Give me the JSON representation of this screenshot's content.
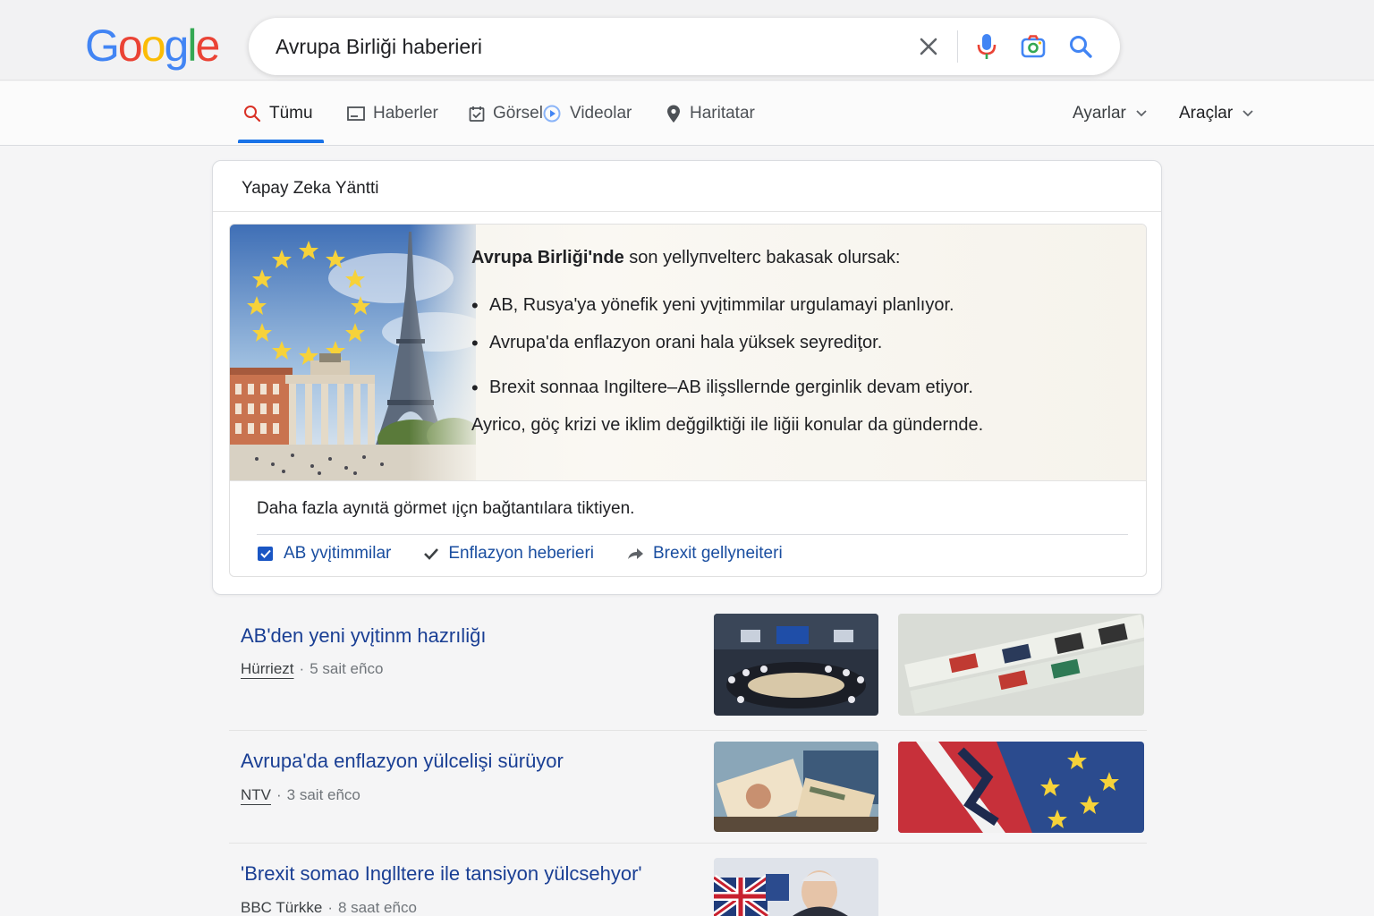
{
  "brand": {
    "logo_letters": [
      {
        "ch": "G",
        "color": "#4285F4"
      },
      {
        "ch": "o",
        "color": "#EA4335"
      },
      {
        "ch": "o",
        "color": "#FBBC05"
      },
      {
        "ch": "g",
        "color": "#4285F4"
      },
      {
        "ch": "l",
        "color": "#34A853"
      },
      {
        "ch": "e",
        "color": "#EA4335"
      }
    ]
  },
  "search": {
    "query": "Avrupa Birliği haberieri",
    "icons": [
      "clear-icon",
      "microphone-icon",
      "camera-lens-icon",
      "search-icon"
    ]
  },
  "tabs": [
    {
      "label": "Tümu",
      "icon": "search-icon",
      "active": true
    },
    {
      "label": "Haberler",
      "icon": "news-icon"
    },
    {
      "label": "Görsel",
      "icon": "image-icon"
    },
    {
      "label": "Videolar",
      "icon": "video-icon"
    },
    {
      "label": "Haritatar",
      "icon": "map-pin-icon"
    }
  ],
  "dropdowns": {
    "settings": "Ayarlar",
    "tools": "Araçlar"
  },
  "ai_answer": {
    "title": "Yapay Zeka Yäntti",
    "intro_bold": "Avrupa Birliği'nde",
    "intro_rest": " son yellyпvelterc bakasak olursak:",
    "bullets": [
      "AB, Rusya'ya yönefik yeni yvįtimmilar urgulamayi planlıyor.",
      "Avrupa'da enflazyon orani hala yüksek seyrediţor.",
      "Brexit sonnaa Ingiltere–AB ilişslleгnde gerginlik devam etiyor."
    ],
    "outro": "Ayrico, göç krizi ve iklim değgilktiği ile liğii konular da gündernde.",
    "more_text": "Daha fazla aynıtä görmet ıįçn bağtantılara tiktiyen.",
    "links": [
      {
        "label": "AB yvįtimmilar",
        "icon": "checkbox-icon"
      },
      {
        "label": "Enflazyon heberieri",
        "icon": "checkmark-icon"
      },
      {
        "label": "Brexit gellyneiteri",
        "icon": "share-arrow-icon"
      }
    ]
  },
  "results": [
    {
      "title": "AB'den yeni yvįtinm hazrıliğı",
      "source": "Hürriezt",
      "time": "5 sait eñco"
    },
    {
      "title": "Avrupa'da enflazyon yülcelişi sürüyor",
      "source": "NTV",
      "time": "3 sait eñco"
    },
    {
      "title": "'Brexit somao Inglltere ile tansiyon yülcsehyor'",
      "source": "BBC Türkke",
      "time": "8 saat eñco"
    }
  ]
}
